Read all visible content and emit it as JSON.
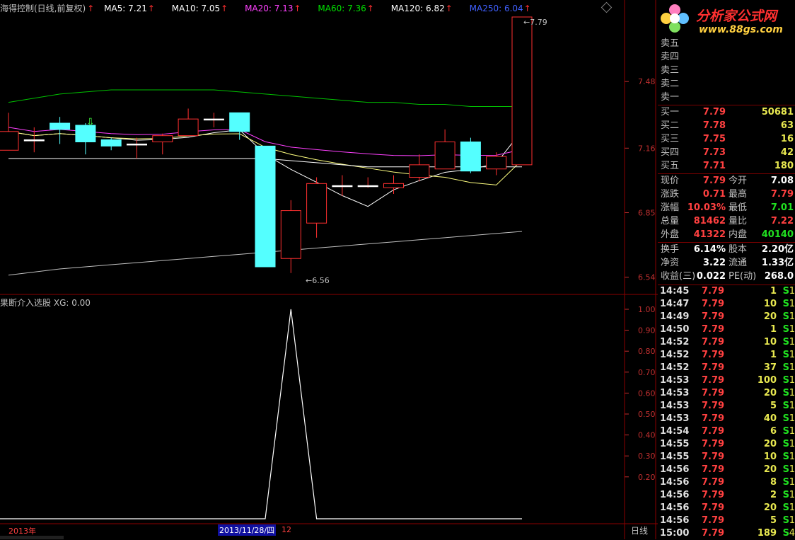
{
  "header": {
    "title": "海得控制(日线,前复权)",
    "ma5": "MA5: 7.21",
    "ma10": "MA10: 7.05",
    "ma20": "MA20: 7.13",
    "ma60": "MA60: 7.36",
    "ma120": "MA120: 6.82",
    "ma250": "MA250: 6.04",
    "colors": {
      "ma5": "#ffffff",
      "ma10": "#ffffff",
      "ma20": "#ff40ff",
      "ma60": "#00e000",
      "ma120": "#ffffff",
      "ma250": "#4060ff"
    }
  },
  "main_chart": {
    "y_ticks": [
      "7.48",
      "7.16",
      "6.85",
      "6.54"
    ],
    "high_label": "7.79",
    "low_label": "6.56",
    "candles": [
      {
        "o": 7.15,
        "c": 7.24,
        "h": 7.33,
        "l": 7.15
      },
      {
        "o": 7.2,
        "c": 7.2,
        "h": 7.26,
        "l": 7.14
      },
      {
        "o": 7.28,
        "c": 7.25,
        "h": 7.31,
        "l": 7.18
      },
      {
        "o": 7.27,
        "c": 7.19,
        "h": 7.28,
        "l": 7.13
      },
      {
        "o": 7.2,
        "c": 7.17,
        "h": 7.21,
        "l": 7.15
      },
      {
        "o": 7.18,
        "c": 7.18,
        "h": 7.21,
        "l": 7.11
      },
      {
        "o": 7.19,
        "c": 7.22,
        "h": 7.23,
        "l": 7.13
      },
      {
        "o": 7.22,
        "c": 7.3,
        "h": 7.35,
        "l": 7.22
      },
      {
        "o": 7.3,
        "c": 7.3,
        "h": 7.33,
        "l": 7.26
      },
      {
        "o": 7.33,
        "c": 7.24,
        "h": 7.33,
        "l": 7.2
      },
      {
        "o": 7.17,
        "c": 6.59,
        "h": 7.17,
        "l": 6.59
      },
      {
        "o": 6.63,
        "c": 6.86,
        "h": 6.91,
        "l": 6.56
      },
      {
        "o": 6.8,
        "c": 6.99,
        "h": 7.02,
        "l": 6.73
      },
      {
        "o": 6.98,
        "c": 6.98,
        "h": 7.03,
        "l": 6.93
      },
      {
        "o": 6.98,
        "c": 6.98,
        "h": 7.02,
        "l": 6.97
      },
      {
        "o": 6.97,
        "c": 6.99,
        "h": 7.03,
        "l": 6.94
      },
      {
        "o": 7.02,
        "c": 7.08,
        "h": 7.13,
        "l": 7.0
      },
      {
        "o": 7.06,
        "c": 7.19,
        "h": 7.25,
        "l": 7.06
      },
      {
        "o": 7.19,
        "c": 7.05,
        "h": 7.21,
        "l": 7.04
      },
      {
        "o": 7.06,
        "c": 7.12,
        "h": 7.14,
        "l": 7.03
      },
      {
        "o": 7.08,
        "c": 7.79,
        "h": 7.79,
        "l": 7.08
      }
    ]
  },
  "indicator": {
    "title": "果断介入选股",
    "xg": "XG: 0.00",
    "y_ticks": [
      "1.00",
      "0.90",
      "0.80",
      "0.70",
      "0.60",
      "0.50",
      "0.40",
      "0.30",
      "0.20"
    ],
    "values": [
      0,
      0,
      0,
      0,
      0,
      0,
      0,
      0,
      0,
      0,
      0,
      1,
      0,
      0,
      0,
      0,
      0,
      0,
      0,
      0,
      0
    ]
  },
  "bottom": {
    "year": "2013年",
    "date": "2013/11/28/四",
    "month": "12",
    "period": "日线"
  },
  "logo": {
    "name": "分析家公式网",
    "url": "www.88gs.com"
  },
  "order_book": {
    "sells": [
      "卖五",
      "卖四",
      "卖三",
      "卖二",
      "卖一"
    ],
    "buys": [
      {
        "label": "买一",
        "price": "7.79",
        "vol": "50681"
      },
      {
        "label": "买二",
        "price": "7.78",
        "vol": "63"
      },
      {
        "label": "买三",
        "price": "7.75",
        "vol": "16"
      },
      {
        "label": "买四",
        "price": "7.73",
        "vol": "42"
      },
      {
        "label": "买五",
        "price": "7.71",
        "vol": "180"
      }
    ]
  },
  "quote": [
    {
      "l1": "现价",
      "v1": "7.79",
      "l2": "今开",
      "v2": "7.08"
    },
    {
      "l1": "涨跌",
      "v1": "0.71",
      "l2": "最高",
      "v2": "7.79"
    },
    {
      "l1": "涨幅",
      "v1": "10.03%",
      "l2": "最低",
      "v2": "7.01"
    },
    {
      "l1": "总量",
      "v1": "81462",
      "l2": "量比",
      "v2": "7.22"
    },
    {
      "l1": "外盘",
      "v1": "41322",
      "l2": "内盘",
      "v2": "40140"
    }
  ],
  "fundamentals": [
    {
      "l1": "换手",
      "v1": "6.14%",
      "l2": "股本",
      "v2": "2.20亿"
    },
    {
      "l1": "净资",
      "v1": "3.22",
      "l2": "流通",
      "v2": "1.33亿"
    },
    {
      "l1": "收益(三)",
      "v1": "0.022",
      "l2": "PE(动)",
      "v2": "268.0"
    }
  ],
  "ticks": [
    {
      "t": "14:45",
      "p": "7.79",
      "q": "1",
      "s": "S",
      "n": "1"
    },
    {
      "t": "14:47",
      "p": "7.79",
      "q": "10",
      "s": "S",
      "n": "1"
    },
    {
      "t": "14:49",
      "p": "7.79",
      "q": "20",
      "s": "S",
      "n": "1"
    },
    {
      "t": "14:50",
      "p": "7.79",
      "q": "1",
      "s": "S",
      "n": "1"
    },
    {
      "t": "14:52",
      "p": "7.79",
      "q": "10",
      "s": "S",
      "n": "1"
    },
    {
      "t": "14:52",
      "p": "7.79",
      "q": "1",
      "s": "S",
      "n": "1"
    },
    {
      "t": "14:52",
      "p": "7.79",
      "q": "37",
      "s": "S",
      "n": "1"
    },
    {
      "t": "14:53",
      "p": "7.79",
      "q": "100",
      "s": "S",
      "n": "1"
    },
    {
      "t": "14:53",
      "p": "7.79",
      "q": "20",
      "s": "S",
      "n": "1"
    },
    {
      "t": "14:53",
      "p": "7.79",
      "q": "5",
      "s": "S",
      "n": "1"
    },
    {
      "t": "14:53",
      "p": "7.79",
      "q": "40",
      "s": "S",
      "n": "1"
    },
    {
      "t": "14:54",
      "p": "7.79",
      "q": "6",
      "s": "S",
      "n": "1"
    },
    {
      "t": "14:55",
      "p": "7.79",
      "q": "20",
      "s": "S",
      "n": "1"
    },
    {
      "t": "14:55",
      "p": "7.79",
      "q": "10",
      "s": "S",
      "n": "1"
    },
    {
      "t": "14:56",
      "p": "7.79",
      "q": "20",
      "s": "S",
      "n": "1"
    },
    {
      "t": "14:56",
      "p": "7.79",
      "q": "8",
      "s": "S",
      "n": "1"
    },
    {
      "t": "14:56",
      "p": "7.79",
      "q": "2",
      "s": "S",
      "n": "1"
    },
    {
      "t": "14:56",
      "p": "7.79",
      "q": "20",
      "s": "S",
      "n": "1"
    },
    {
      "t": "14:56",
      "p": "7.79",
      "q": "5",
      "s": "S",
      "n": "1"
    },
    {
      "t": "15:00",
      "p": "7.79",
      "q": "189",
      "s": "S",
      "n": "4"
    }
  ]
}
